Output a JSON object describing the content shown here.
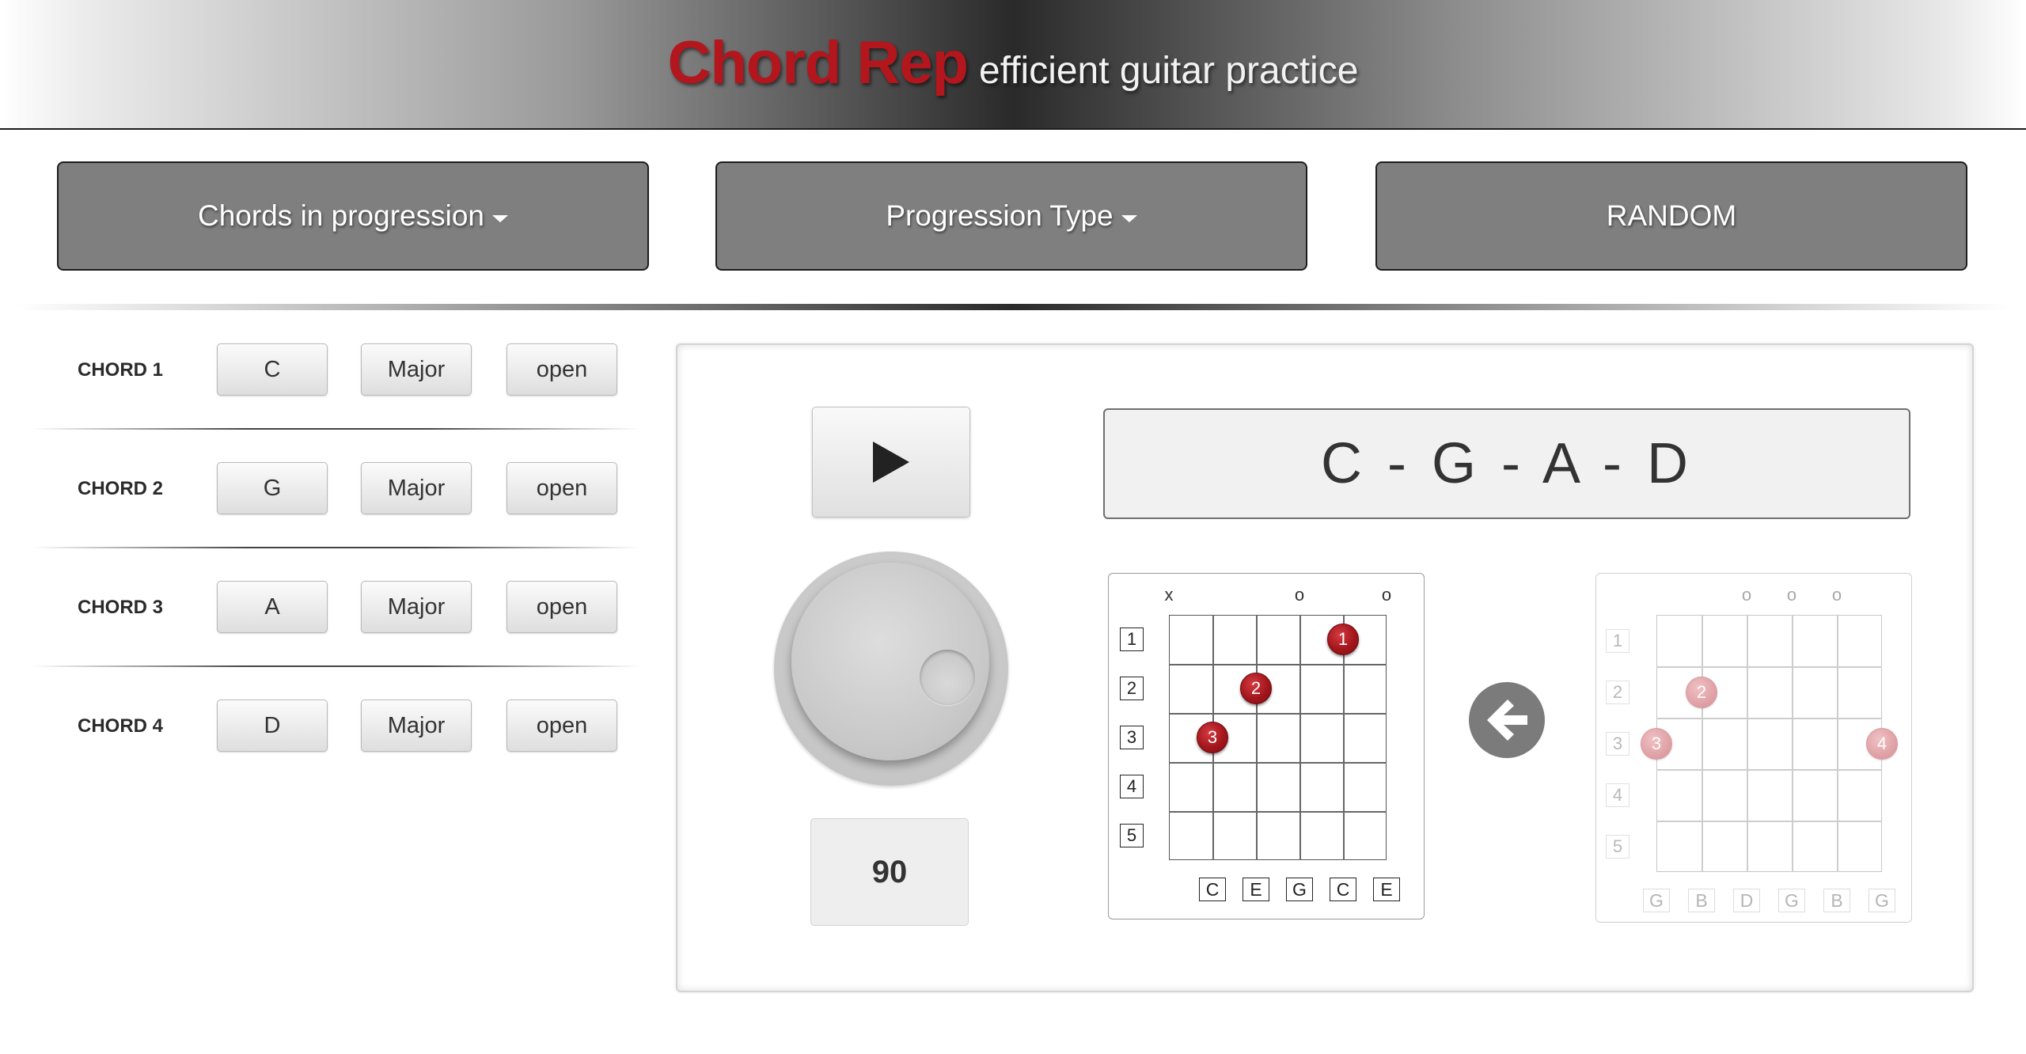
{
  "header": {
    "brand": "Chord Rep",
    "tagline": "efficient guitar practice"
  },
  "toolbar": {
    "chords_label": "Chords in progression",
    "type_label": "Progression Type",
    "random_label": "RANDOM"
  },
  "chords": [
    {
      "label": "CHORD 1",
      "root": "C",
      "quality": "Major",
      "voicing": "open"
    },
    {
      "label": "CHORD 2",
      "root": "G",
      "quality": "Major",
      "voicing": "open"
    },
    {
      "label": "CHORD 3",
      "root": "A",
      "quality": "Major",
      "voicing": "open"
    },
    {
      "label": "CHORD 4",
      "root": "D",
      "quality": "Major",
      "voicing": "open"
    }
  ],
  "player": {
    "tempo": "90",
    "progression": "C - G - A - D"
  },
  "current_chord": {
    "fret_numbers": [
      "1",
      "2",
      "3",
      "4",
      "5"
    ],
    "string_marks": [
      "x",
      "",
      "",
      "o",
      "",
      "o"
    ],
    "fingers": [
      {
        "label": "1",
        "string": 5,
        "fret": 1
      },
      {
        "label": "2",
        "string": 3,
        "fret": 2
      },
      {
        "label": "3",
        "string": 2,
        "fret": 3
      }
    ],
    "notes": [
      "C",
      "E",
      "G",
      "C",
      "E"
    ]
  },
  "next_chord": {
    "fret_numbers": [
      "1",
      "2",
      "3",
      "4",
      "5"
    ],
    "string_marks": [
      "",
      "",
      "o",
      "o",
      "o",
      ""
    ],
    "fingers": [
      {
        "label": "2",
        "string": 2,
        "fret": 2
      },
      {
        "label": "3",
        "string": 1,
        "fret": 3
      },
      {
        "label": "4",
        "string": 6,
        "fret": 3
      }
    ],
    "notes": [
      "G",
      "B",
      "D",
      "G",
      "B",
      "G"
    ]
  },
  "colors": {
    "brand": "#b3161c",
    "finger": "#a2161c",
    "button": "#7f7f7f"
  }
}
